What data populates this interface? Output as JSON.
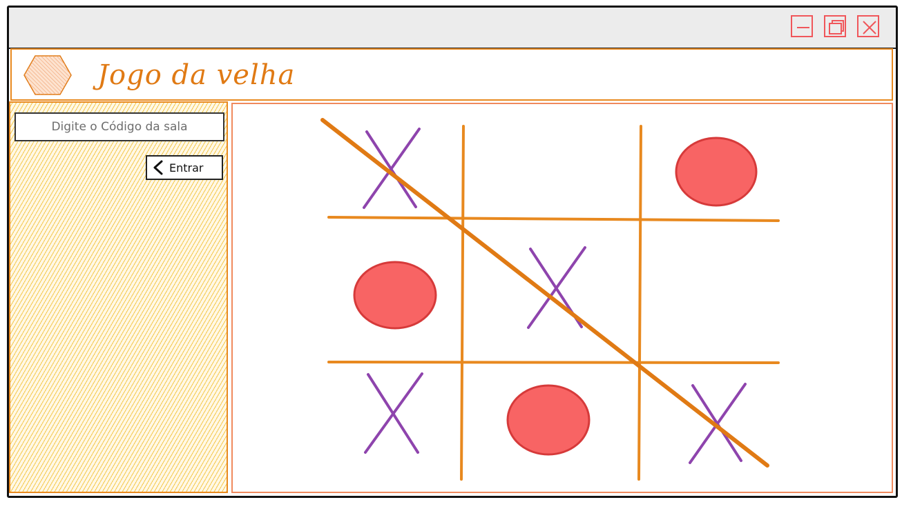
{
  "window": {
    "controls": [
      "minimize-icon",
      "maximize-icon",
      "close-icon"
    ],
    "accent_color": "#f0565a"
  },
  "header": {
    "title": "Jogo da velha",
    "logo_icon": "hexagon-icon",
    "color": "#e07a14"
  },
  "sidebar": {
    "room_input": {
      "placeholder": "Digite o Código da sala",
      "value": ""
    },
    "enter_button": {
      "label": "Entrar",
      "icon": "chevron-left-icon"
    },
    "fill_color": "#f5c84a"
  },
  "board": {
    "grid_color": "#e8891f",
    "x_color": "#8e44ad",
    "o_color": "#f86464",
    "cells": [
      [
        "X",
        "",
        "O"
      ],
      [
        "O",
        "X",
        ""
      ],
      [
        "X",
        "O",
        "X"
      ]
    ],
    "winning_line": "diagonal-top-left-to-bottom-right"
  }
}
